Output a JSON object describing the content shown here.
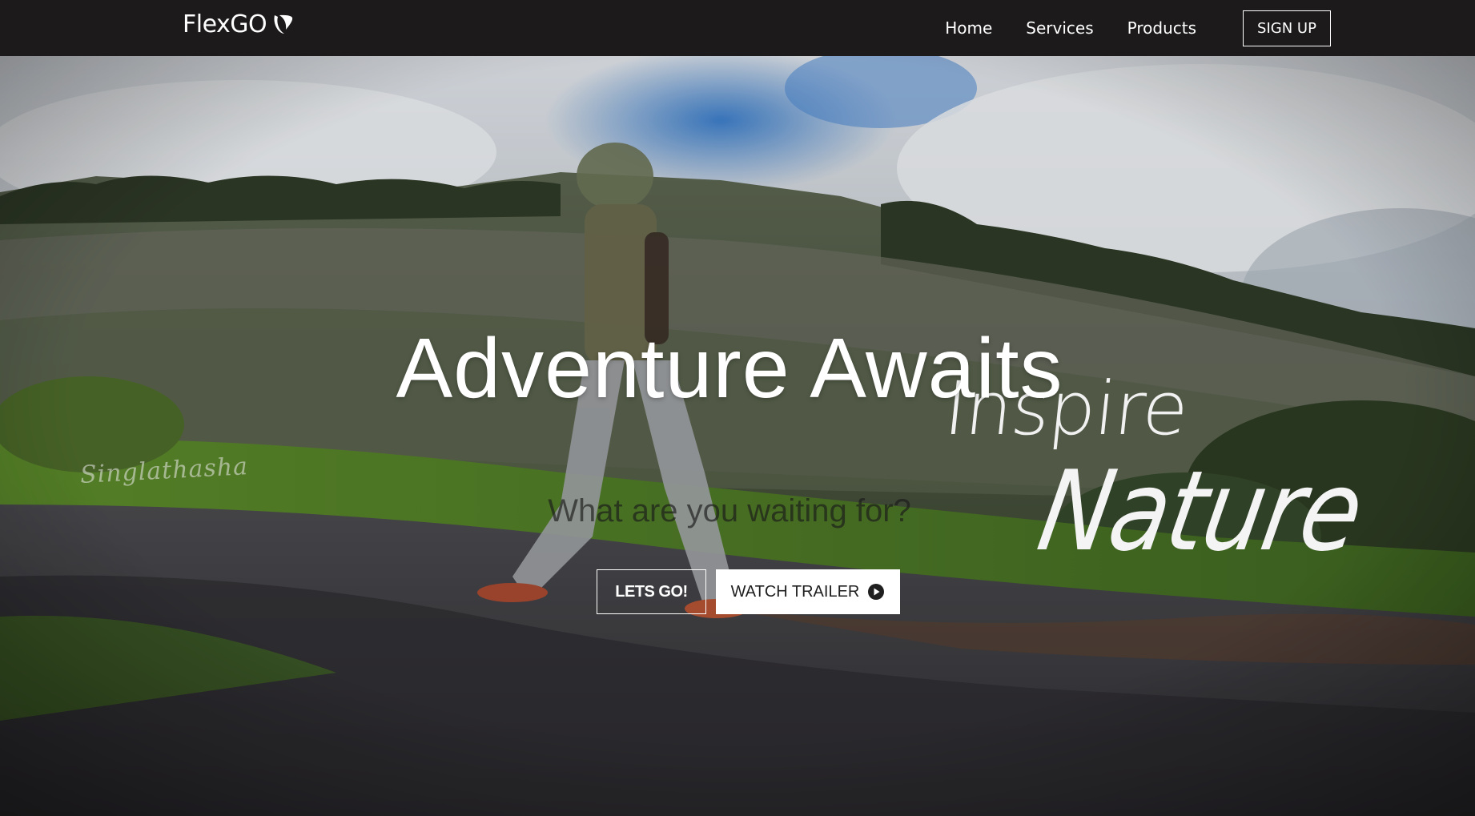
{
  "navbar": {
    "brand": "FlexGO",
    "brand_icon": "typo3-icon",
    "links": [
      "Home",
      "Services",
      "Products"
    ],
    "signup_label": "SIGN UP"
  },
  "hero": {
    "title": "Adventure Awaits",
    "subtitle": "What are you waiting for?",
    "primary_button": "LETS GO!",
    "secondary_button": "WATCH TRAILER",
    "secondary_button_icon": "play-circle-icon",
    "video_overlay_inspire": "Inspire",
    "video_overlay_nature": "Nature",
    "watermark": "Singlathasha"
  },
  "colors": {
    "navbar_bg": "#1c1a1b",
    "text_light": "#ffffff",
    "button_solid_bg": "#ffffff",
    "button_solid_text": "#1f1f1f"
  }
}
